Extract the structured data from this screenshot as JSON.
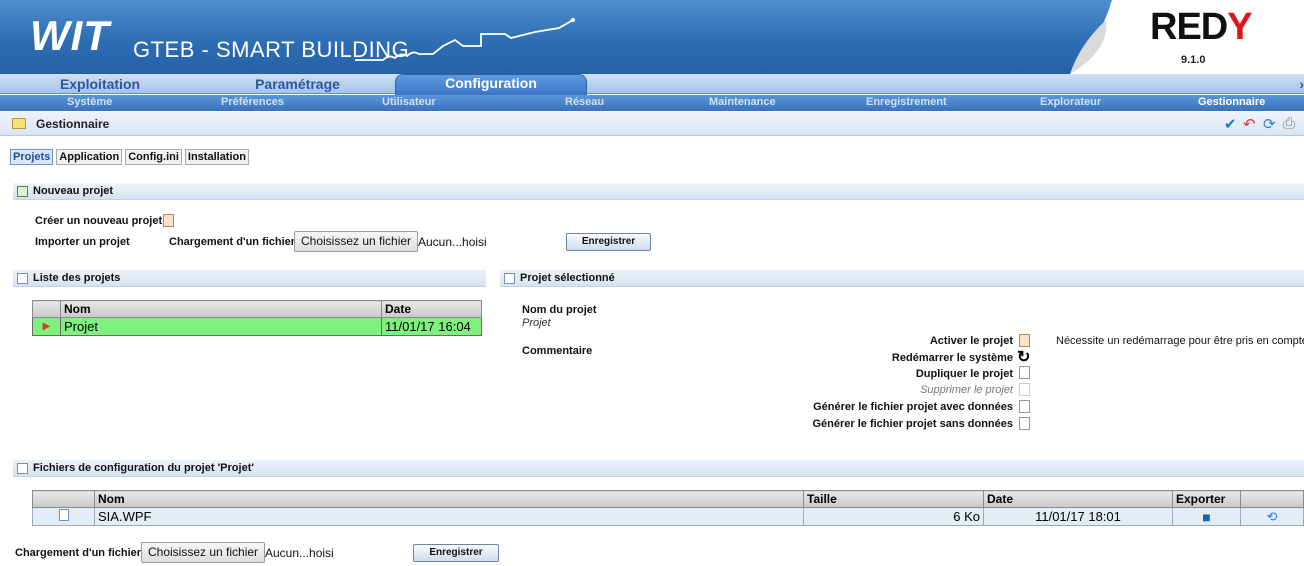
{
  "brand": {
    "logo": "WIT",
    "title": "GTEB - SMART BUILDING",
    "product": "REDY",
    "version": "9.1.0"
  },
  "colors": {
    "accent": "#2d6eb4",
    "selected_row": "#7ef17e",
    "redy_red": "#e0141d"
  },
  "main_tabs": [
    {
      "label": "Exploitation",
      "active": false
    },
    {
      "label": "Paramétrage",
      "active": false
    },
    {
      "label": "Configuration",
      "active": true
    }
  ],
  "sub_nav": [
    {
      "label": "Système",
      "active": false
    },
    {
      "label": "Préférences",
      "active": false
    },
    {
      "label": "Utilisateur",
      "active": false
    },
    {
      "label": "Réseau",
      "active": false
    },
    {
      "label": "Maintenance",
      "active": false
    },
    {
      "label": "Enregistrement",
      "active": false
    },
    {
      "label": "Explorateur",
      "active": false
    },
    {
      "label": "Gestionnaire",
      "active": true
    }
  ],
  "page_title": "Gestionnaire",
  "toolbar_icons": [
    "check-icon",
    "undo-icon",
    "refresh-icon",
    "print-icon"
  ],
  "sub_tabs": [
    {
      "label": "Projets",
      "active": true
    },
    {
      "label": "Application",
      "active": false
    },
    {
      "label": "Config.ini",
      "active": false
    },
    {
      "label": "Installation",
      "active": false
    }
  ],
  "new_project": {
    "header": "Nouveau projet",
    "create_label": "Créer un nouveau projet",
    "import_label": "Importer un projet",
    "upload_label": "Chargement d'un fichier",
    "file_button": "Choisissez un fichier",
    "file_none": "Aucun...hoisi",
    "save_button": "Enregistrer"
  },
  "project_list": {
    "header": "Liste des projets",
    "columns": [
      "Nom",
      "Date"
    ],
    "rows": [
      {
        "name": "Projet",
        "date": "11/01/17 16:04"
      }
    ]
  },
  "selected_project": {
    "header": "Projet sélectionné",
    "name_label": "Nom du projet",
    "name_value": "Projet",
    "comment_label": "Commentaire",
    "actions": [
      {
        "label": "Activer le projet",
        "enabled": true,
        "icon": "activate-icon"
      },
      {
        "label": "Redémarrer le système",
        "enabled": true,
        "icon": "restart-icon"
      },
      {
        "label": "Dupliquer le projet",
        "enabled": true,
        "icon": "duplicate-icon"
      },
      {
        "label": "Supprimer le projet",
        "enabled": false,
        "icon": "delete-icon"
      },
      {
        "label": "Générer le fichier projet avec données",
        "enabled": true,
        "icon": "generate-with-data-icon"
      },
      {
        "label": "Générer le fichier projet sans données",
        "enabled": true,
        "icon": "generate-without-data-icon"
      }
    ],
    "note": "Nécessite un redémarrage pour être pris en compte"
  },
  "config_files": {
    "header": "Fichiers de configuration du projet 'Projet'",
    "columns": [
      "Nom",
      "Taille",
      "Date",
      "Exporter"
    ],
    "rows": [
      {
        "name": "SIA.WPF",
        "size": "6 Ko",
        "date": "11/01/17 18:01"
      }
    ],
    "upload_label": "Chargement d'un fichier",
    "file_button": "Choisissez un fichier",
    "file_none": "Aucun...hoisi",
    "save_button": "Enregistrer"
  }
}
